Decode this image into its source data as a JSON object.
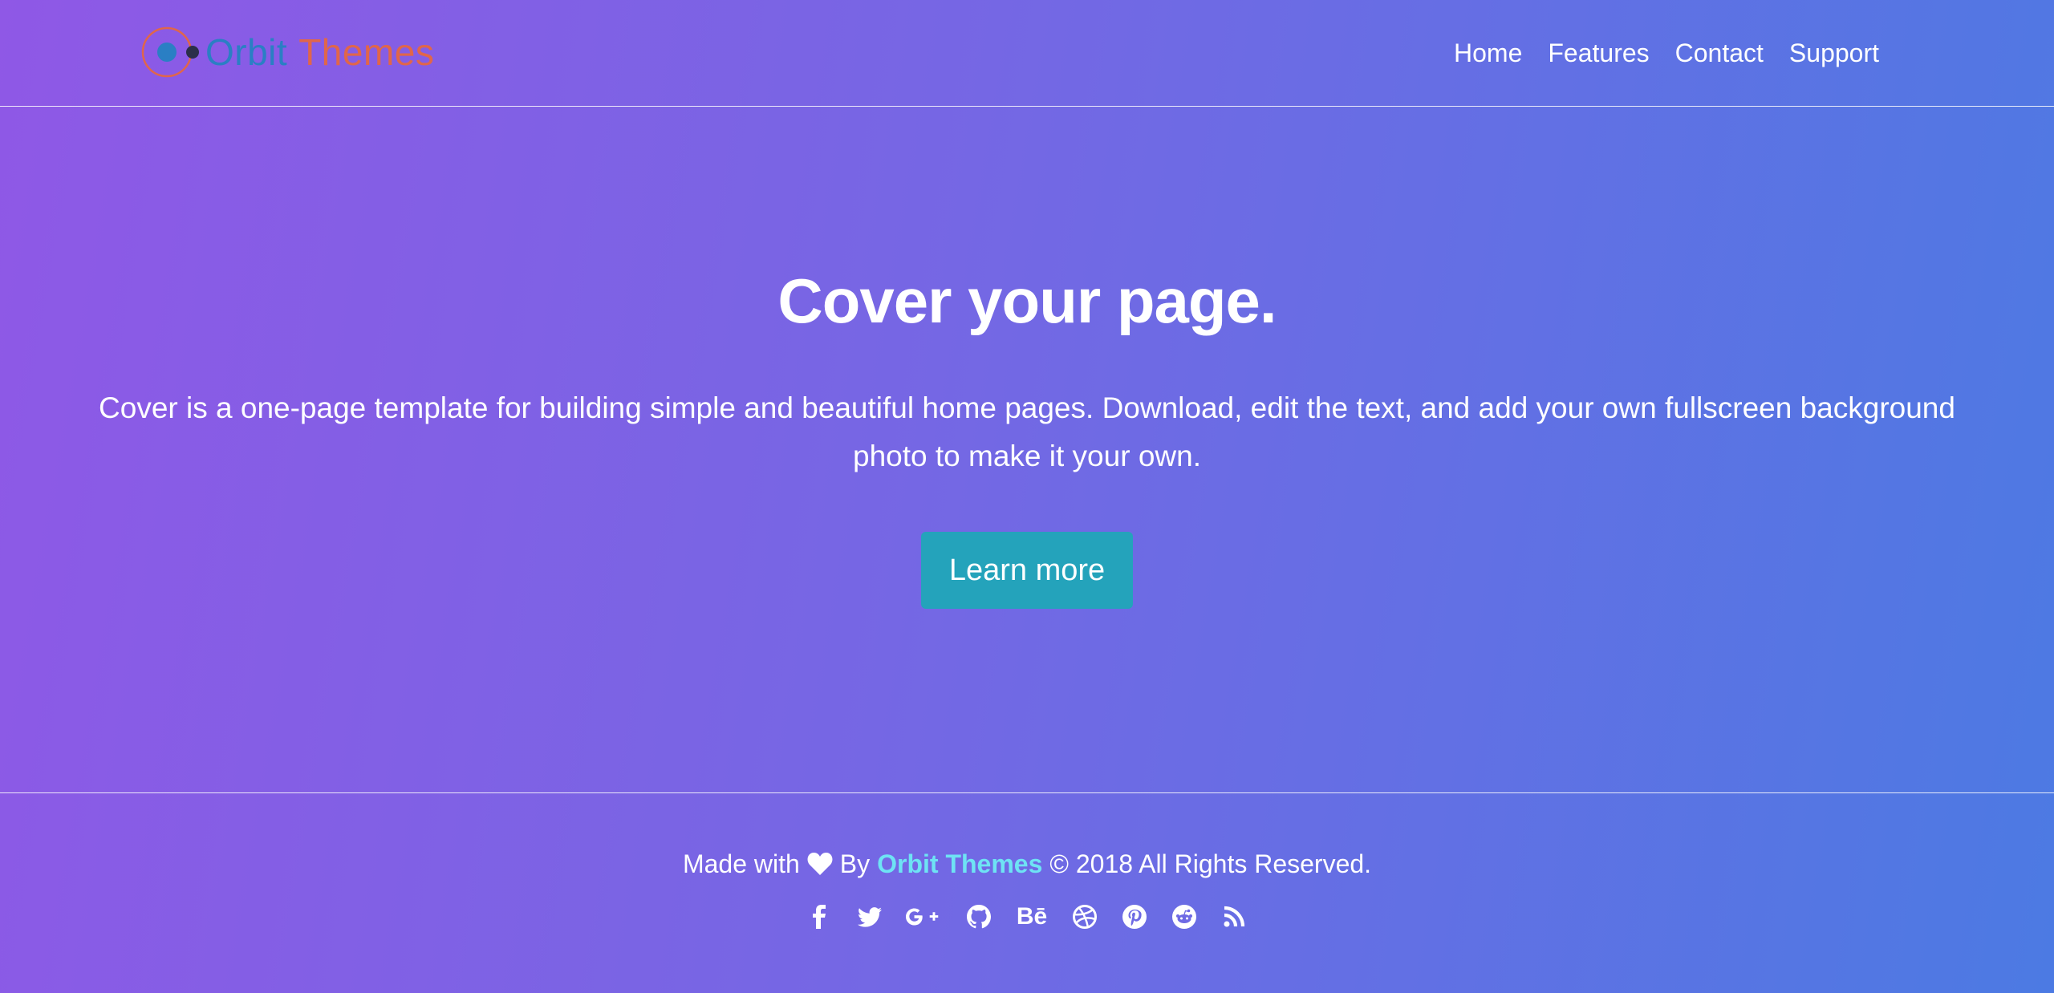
{
  "header": {
    "logo": {
      "word1": "Orbit",
      "word2": "Themes",
      "icon": "orbit-logo-icon"
    },
    "nav": [
      {
        "label": "Home"
      },
      {
        "label": "Features"
      },
      {
        "label": "Contact"
      },
      {
        "label": "Support"
      }
    ]
  },
  "hero": {
    "title": "Cover your page.",
    "lead": "Cover is a one-page template for building simple and beautiful home pages. Download, edit the text, and add your own fullscreen background photo to make it your own.",
    "button_label": "Learn more"
  },
  "footer": {
    "made_with": "Made with",
    "by": "By",
    "brand": "Orbit Themes",
    "rights": "© 2018 All Rights Reserved.",
    "social": [
      {
        "icon": "facebook-icon"
      },
      {
        "icon": "twitter-icon"
      },
      {
        "icon": "google-plus-icon"
      },
      {
        "icon": "github-icon"
      },
      {
        "icon": "behance-icon"
      },
      {
        "icon": "dribbble-icon"
      },
      {
        "icon": "pinterest-icon"
      },
      {
        "icon": "reddit-icon"
      },
      {
        "icon": "rss-icon"
      }
    ]
  },
  "colors": {
    "gradient_start": "#8f58e6",
    "gradient_end": "#4c7ae3",
    "button": "#24a3bb",
    "brand_link": "#6ee3f4",
    "logo_orbit": "#2a7fc4",
    "logo_themes": "#e0664a"
  }
}
